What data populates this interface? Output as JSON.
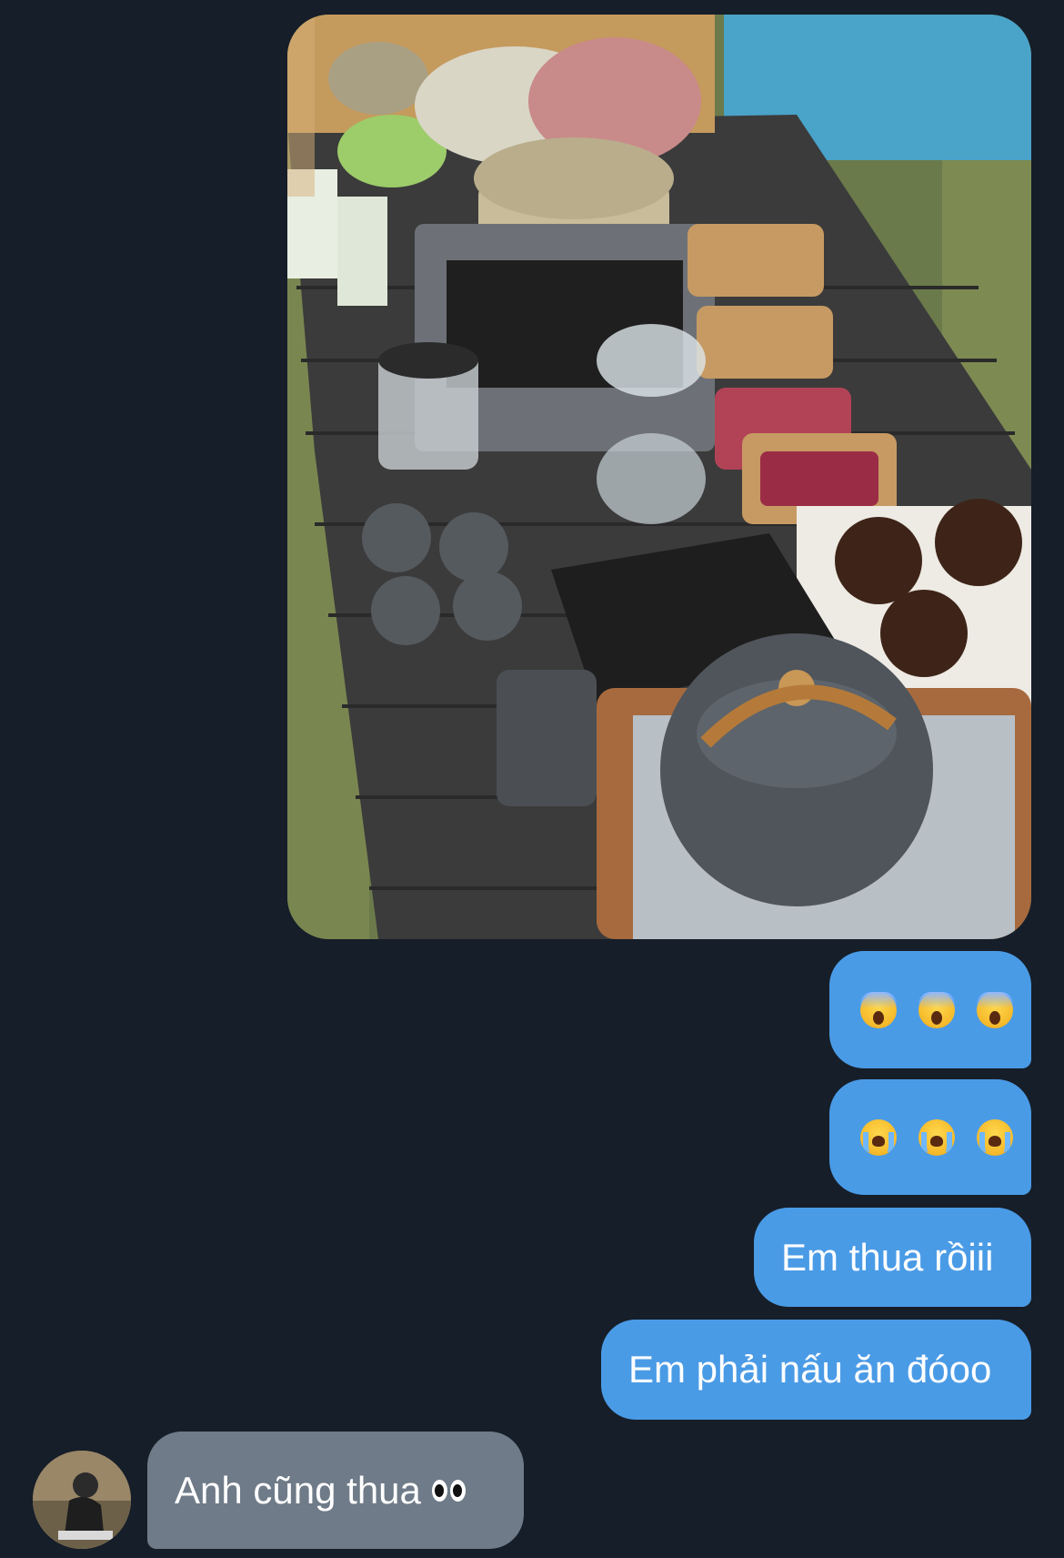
{
  "messages": [
    {
      "type": "image",
      "direction": "outgoing",
      "alt_icon": "photo-thumbnail"
    },
    {
      "type": "emoji",
      "direction": "outgoing",
      "emoji": [
        "face-screaming-in-fear",
        "face-screaming-in-fear",
        "face-screaming-in-fear"
      ]
    },
    {
      "type": "emoji",
      "direction": "outgoing",
      "emoji": [
        "loudly-crying-face",
        "loudly-crying-face",
        "loudly-crying-face"
      ]
    },
    {
      "type": "text",
      "direction": "outgoing",
      "text": "Em thua rồiii"
    },
    {
      "type": "text",
      "direction": "outgoing",
      "text": "Em phải nấu ăn đóoo"
    },
    {
      "type": "text",
      "direction": "incoming",
      "text": "Anh cũng thua",
      "trailing_emoji": "eyes"
    }
  ],
  "colors": {
    "background": "#161e29",
    "outgoing_bubble": "#4a9be6",
    "incoming_bubble": "#6f7b88",
    "text": "#ffffff"
  }
}
